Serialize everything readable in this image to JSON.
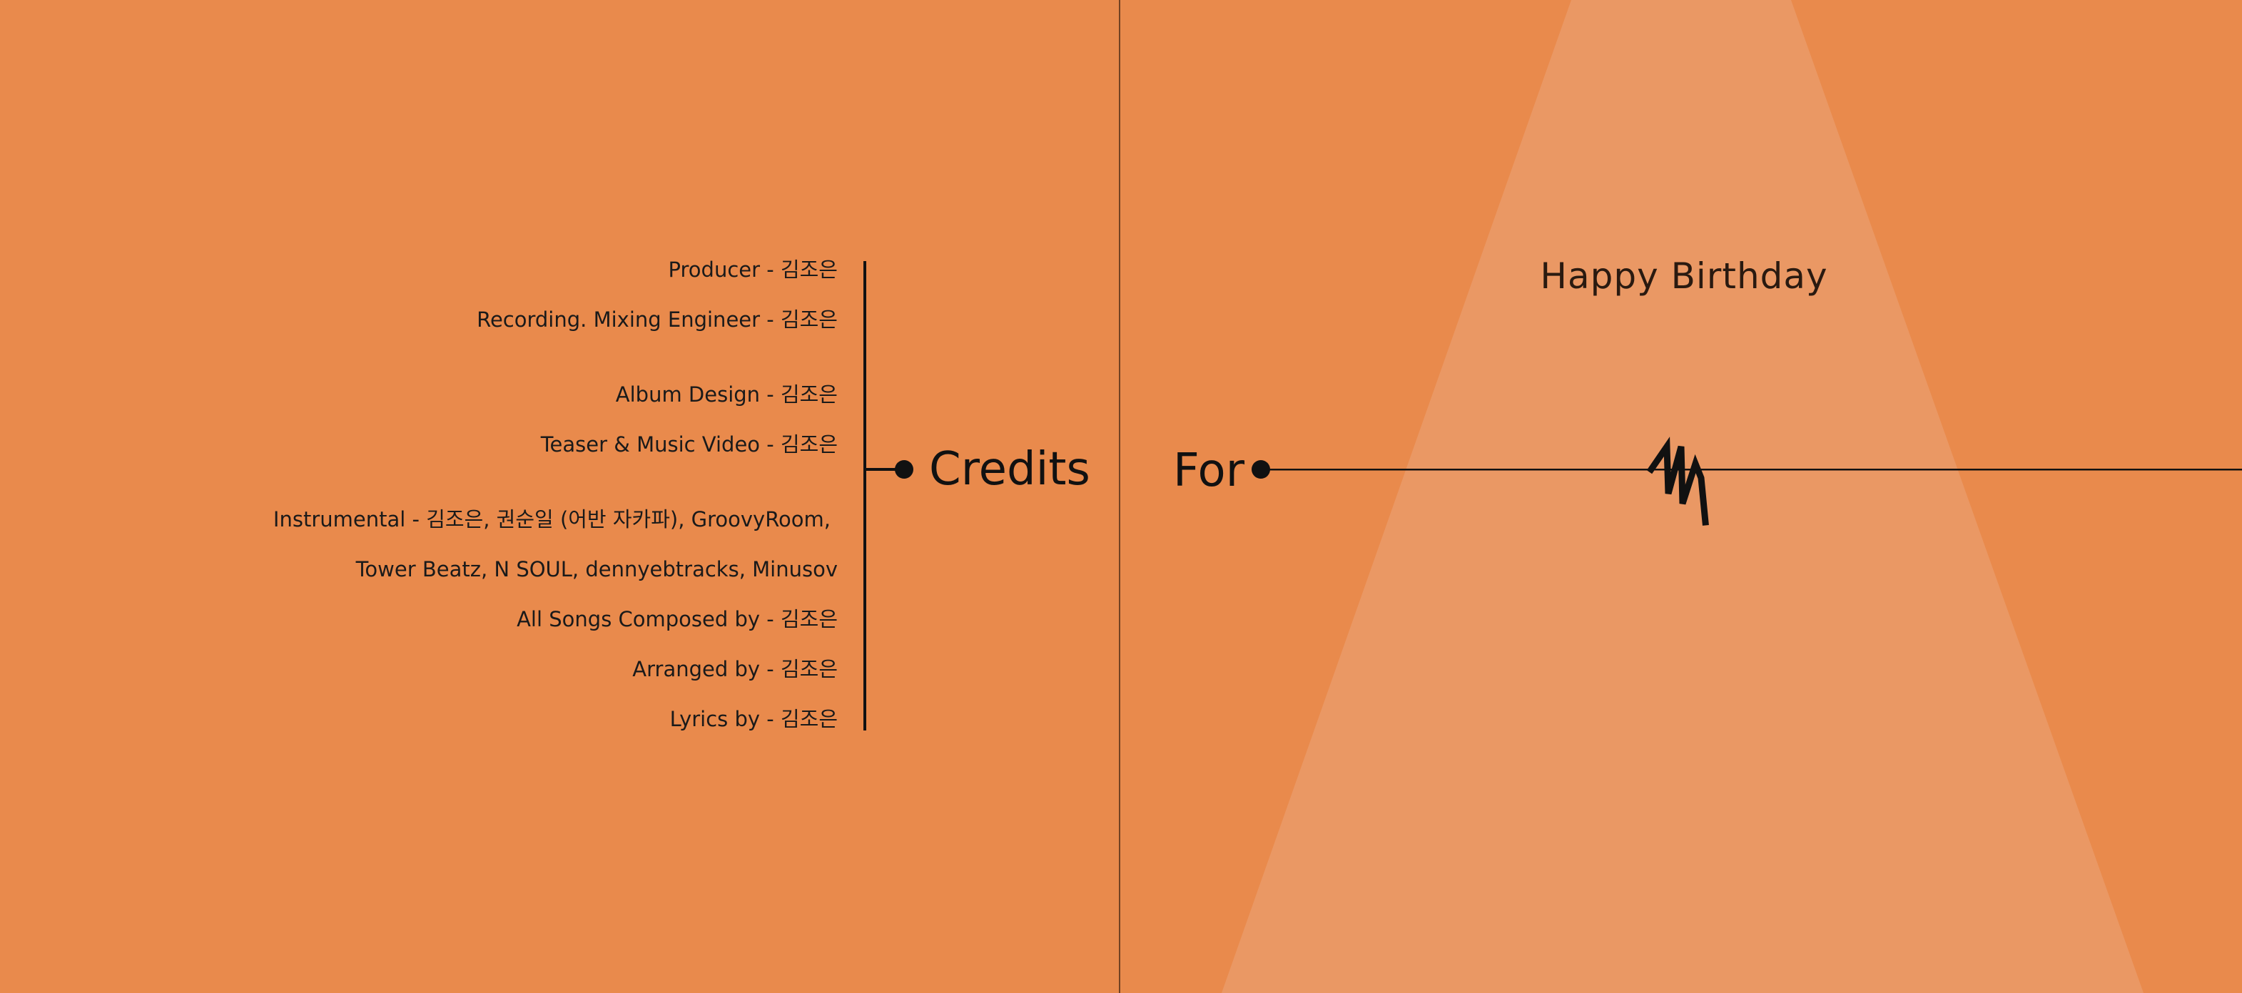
{
  "colors": {
    "background": "#E98A4C",
    "spotlight": "#EA9864",
    "ink": "#111111"
  },
  "credits": {
    "title": "Credits",
    "lines": [
      "Producer - 김조은",
      "Recording. Mixing Engineer - 김조은",
      "Album Design - 김조은",
      "Teaser & Music Video - 김조은",
      "Instrumental - 김조은, 권순일 (어반 자카파), GroovyRoom,",
      "Tower Beatz, N SOUL, dennyebtracks, Minusov",
      "All Songs Composed by - 김조은",
      "Arranged by - 김조은",
      "Lyrics by - 김조은"
    ]
  },
  "cover": {
    "for_label": "For",
    "title": "Happy Birthday",
    "logo_icon": "zigzag-logo-icon"
  }
}
